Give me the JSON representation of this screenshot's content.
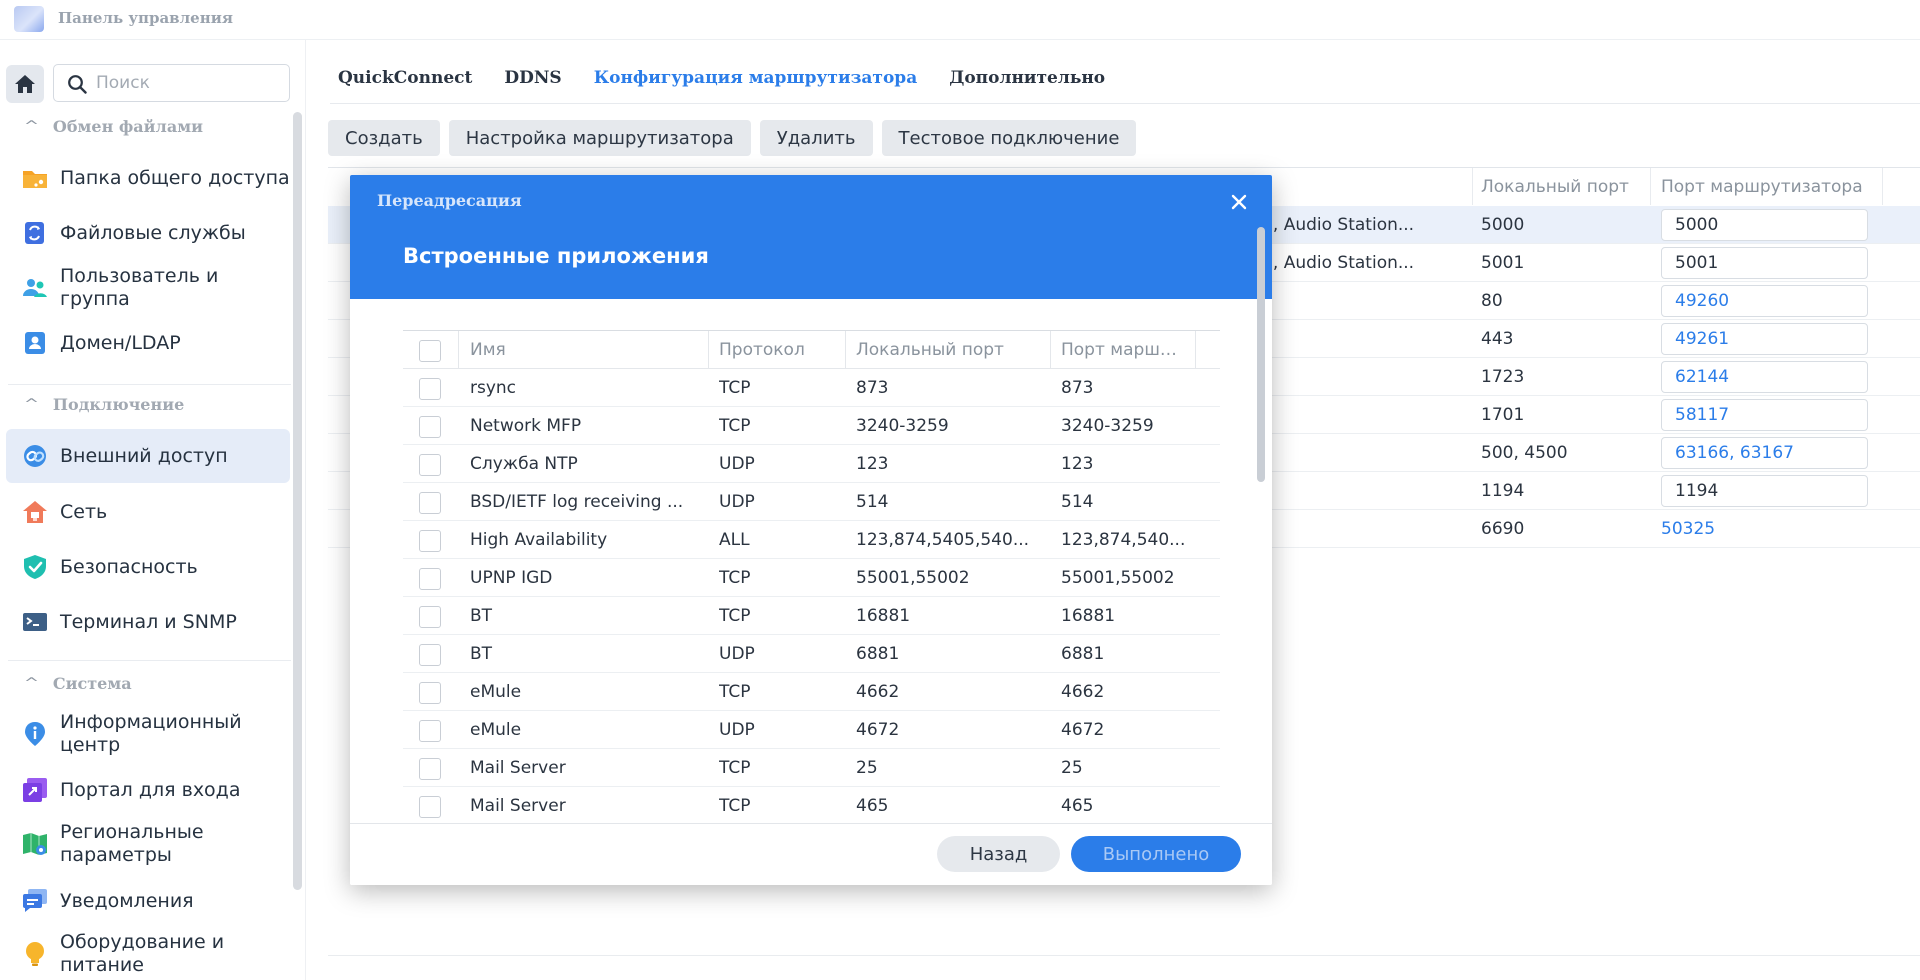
{
  "window": {
    "title": "Панель управления",
    "app_icon": "control-panel-icon"
  },
  "sidebar": {
    "search_placeholder": "Поиск",
    "sections": [
      {
        "title": "Обмен файлами",
        "items": [
          {
            "label": "Папка общего доступа",
            "icon": "shared-folder-icon"
          },
          {
            "label": "Файловые службы",
            "icon": "file-services-icon"
          },
          {
            "label": "Пользователь и группа",
            "icon": "user-group-icon"
          },
          {
            "label": "Домен/LDAP",
            "icon": "domain-ldap-icon"
          }
        ]
      },
      {
        "title": "Подключение",
        "items": [
          {
            "label": "Внешний доступ",
            "icon": "external-access-icon",
            "active": true
          },
          {
            "label": "Сеть",
            "icon": "network-icon"
          },
          {
            "label": "Безопасность",
            "icon": "security-shield-icon"
          },
          {
            "label": "Терминал и SNMP",
            "icon": "terminal-icon"
          }
        ]
      },
      {
        "title": "Система",
        "items": [
          {
            "label": "Информационный центр",
            "icon": "info-center-icon"
          },
          {
            "label": "Портал для входа",
            "icon": "login-portal-icon"
          },
          {
            "label": "Региональные параметры",
            "icon": "regional-options-icon"
          },
          {
            "label": "Уведомления",
            "icon": "notifications-icon"
          },
          {
            "label": "Оборудование и питание",
            "icon": "hardware-power-icon"
          }
        ]
      }
    ]
  },
  "main": {
    "tabs": [
      {
        "label": "QuickConnect"
      },
      {
        "label": "DDNS"
      },
      {
        "label": "Конфигурация маршрутизатора",
        "active": true
      },
      {
        "label": "Дополнительно"
      }
    ],
    "toolbar": {
      "create": "Создать",
      "router_setup": "Настройка маршрутизатора",
      "delete": "Удалить",
      "test_connection": "Тестовое подключение"
    },
    "columns": {
      "local_port": "Локальный порт",
      "router_port": "Порт маршрутизатора"
    },
    "rows": [
      {
        "service": "zation, Audio Station...",
        "local_port": "5000",
        "router_port": "5000",
        "router_link": false,
        "router_style": "field",
        "selected": true
      },
      {
        "service": "zation, Audio Station...",
        "local_port": "5001",
        "router_port": "5001",
        "router_link": false,
        "router_style": "field"
      },
      {
        "service": "",
        "local_port": "80",
        "router_port": "49260",
        "router_link": true,
        "router_style": "field"
      },
      {
        "service": "",
        "local_port": "443",
        "router_port": "49261",
        "router_link": true,
        "router_style": "field"
      },
      {
        "service": "",
        "local_port": "1723",
        "router_port": "62144",
        "router_link": true,
        "router_style": "field"
      },
      {
        "service": "",
        "local_port": "1701",
        "router_port": "58117",
        "router_link": true,
        "router_style": "field"
      },
      {
        "service": "",
        "local_port": "500, 4500",
        "router_port": "63166, 63167",
        "router_link": true,
        "router_style": "field"
      },
      {
        "service": "",
        "local_port": "1194",
        "router_port": "1194",
        "router_link": false,
        "router_style": "field"
      },
      {
        "service": "",
        "local_port": "6690",
        "router_port": "50325",
        "router_link": true,
        "router_style": "text"
      }
    ]
  },
  "modal": {
    "title": "Переадресация",
    "heading": "Встроенные приложения",
    "columns": {
      "name": "Имя",
      "protocol": "Протокол",
      "local_port": "Локальный порт",
      "router_port": "Порт маршр..."
    },
    "rows": [
      {
        "name": "rsync",
        "protocol": "TCP",
        "local_port": "873",
        "router_port": "873"
      },
      {
        "name": "Network MFP",
        "protocol": "TCP",
        "local_port": "3240-3259",
        "router_port": "3240-3259"
      },
      {
        "name": "Служба NTP",
        "protocol": "UDP",
        "local_port": "123",
        "router_port": "123"
      },
      {
        "name": "BSD/IETF log receiving ...",
        "protocol": "UDP",
        "local_port": "514",
        "router_port": "514"
      },
      {
        "name": "High Availability",
        "protocol": "ALL",
        "local_port": "123,874,5405,540...",
        "router_port": "123,874,540..."
      },
      {
        "name": "UPNP IGD",
        "protocol": "TCP",
        "local_port": "55001,55002",
        "router_port": "55001,55002"
      },
      {
        "name": "BT",
        "protocol": "TCP",
        "local_port": "16881",
        "router_port": "16881"
      },
      {
        "name": "BT",
        "protocol": "UDP",
        "local_port": "6881",
        "router_port": "6881"
      },
      {
        "name": "eMule",
        "protocol": "TCP",
        "local_port": "4662",
        "router_port": "4662"
      },
      {
        "name": "eMule",
        "protocol": "UDP",
        "local_port": "4672",
        "router_port": "4672"
      },
      {
        "name": "Mail Server",
        "protocol": "TCP",
        "local_port": "25",
        "router_port": "25"
      },
      {
        "name": "Mail Server",
        "protocol": "TCP",
        "local_port": "465",
        "router_port": "465"
      }
    ],
    "back_label": "Назад",
    "done_label": "Выполнено",
    "close_icon": "close-icon"
  },
  "colors": {
    "accent": "#2b7de9",
    "active_nav_bg": "#e5ecf8",
    "button_bg": "#e6e9ed",
    "selected_row_bg": "#eaf0fa"
  }
}
